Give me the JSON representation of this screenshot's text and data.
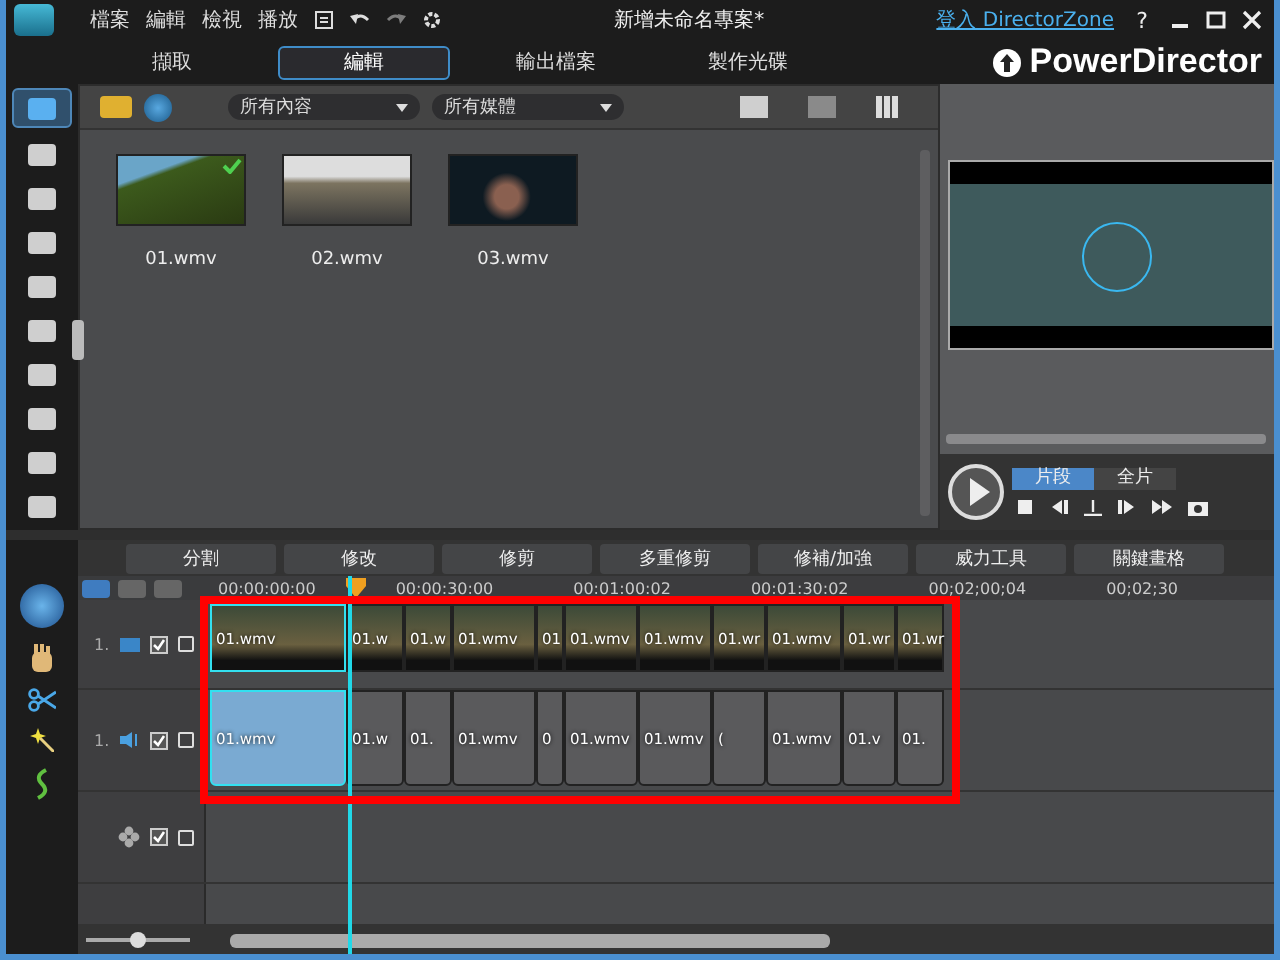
{
  "window": {
    "title": "新增未命名專案*",
    "menu": [
      "檔案",
      "編輯",
      "檢視",
      "播放"
    ],
    "login_link": "登入 DirectorZone",
    "help": "?"
  },
  "mode_tabs": [
    {
      "label": "擷取",
      "selected": false
    },
    {
      "label": "編輯",
      "selected": true
    },
    {
      "label": "輸出檔案",
      "selected": false
    },
    {
      "label": "製作光碟",
      "selected": false
    }
  ],
  "logo": "PowerDirector",
  "rooms": [
    {
      "selected": true
    },
    {
      "selected": false
    },
    {
      "selected": false
    },
    {
      "selected": false
    },
    {
      "selected": false
    },
    {
      "selected": false
    },
    {
      "selected": false
    },
    {
      "selected": false
    },
    {
      "selected": false
    },
    {
      "selected": false
    }
  ],
  "library": {
    "filters": [
      "所有內容",
      "所有媒體"
    ],
    "items": [
      {
        "name": "01.wmv",
        "used": true
      },
      {
        "name": "02.wmv",
        "used": false
      },
      {
        "name": "03.wmv",
        "used": false
      }
    ]
  },
  "preview": {
    "modes": [
      {
        "label": "片段",
        "selected": true
      },
      {
        "label": "全片",
        "selected": false
      }
    ]
  },
  "edit_tools": [
    "分割",
    "修改",
    "修剪",
    "多重修剪",
    "修補/加強",
    "威力工具",
    "關鍵畫格"
  ],
  "ruler": [
    "00:00:00:00",
    "00:00:30:00",
    "00:01:00:02",
    "00:01:30:02",
    "00;02;00;04",
    "00;02;30"
  ],
  "tracks": [
    {
      "kind": "video",
      "number": "1.",
      "enabled": true,
      "clips": [
        {
          "label": "01.wmv",
          "selected": true
        },
        {
          "label": "01.w",
          "selected": false
        },
        {
          "label": "01.w",
          "selected": false
        },
        {
          "label": "01.wmv",
          "selected": false
        },
        {
          "label": "01",
          "selected": false
        },
        {
          "label": "01.wmv",
          "selected": false
        },
        {
          "label": "01.wmv",
          "selected": false
        },
        {
          "label": "01.wr",
          "selected": false
        },
        {
          "label": "01.wmv",
          "selected": false
        },
        {
          "label": "01.wr",
          "selected": false
        },
        {
          "label": "01.wr",
          "selected": false
        }
      ]
    },
    {
      "kind": "audio",
      "number": "1.",
      "enabled": true,
      "clips": [
        {
          "label": "01.wmv",
          "selected": true
        },
        {
          "label": "01.w",
          "selected": false
        },
        {
          "label": "01.",
          "selected": false
        },
        {
          "label": "01.wmv",
          "selected": false
        },
        {
          "label": "0",
          "selected": false
        },
        {
          "label": "01.wmv",
          "selected": false
        },
        {
          "label": "01.wmv",
          "selected": false
        },
        {
          "label": "(",
          "selected": false
        },
        {
          "label": "01.wmv",
          "selected": false
        },
        {
          "label": "01.v",
          "selected": false
        },
        {
          "label": "01.",
          "selected": false
        }
      ]
    },
    {
      "kind": "effect",
      "enabled": true
    }
  ],
  "timeline_zoom": {
    "level": 0.5
  }
}
